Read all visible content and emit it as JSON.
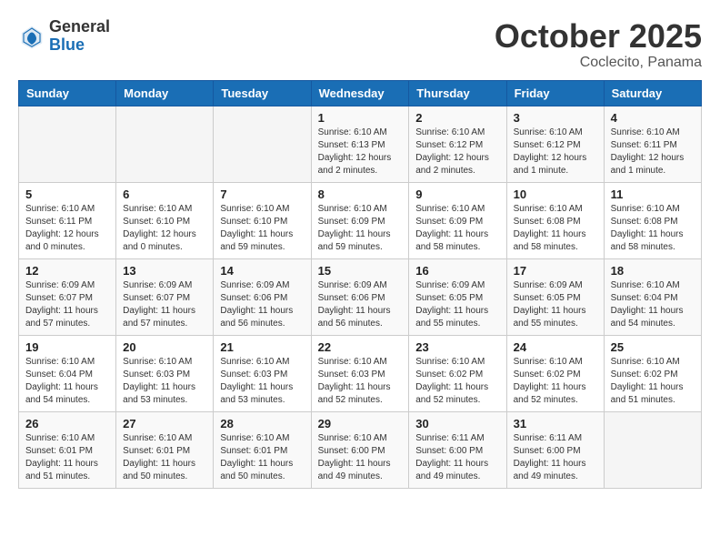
{
  "header": {
    "logo_general": "General",
    "logo_blue": "Blue",
    "month_title": "October 2025",
    "location": "Coclecito, Panama"
  },
  "days_of_week": [
    "Sunday",
    "Monday",
    "Tuesday",
    "Wednesday",
    "Thursday",
    "Friday",
    "Saturday"
  ],
  "weeks": [
    [
      {
        "day": "",
        "info": ""
      },
      {
        "day": "",
        "info": ""
      },
      {
        "day": "",
        "info": ""
      },
      {
        "day": "1",
        "info": "Sunrise: 6:10 AM\nSunset: 6:13 PM\nDaylight: 12 hours\nand 2 minutes."
      },
      {
        "day": "2",
        "info": "Sunrise: 6:10 AM\nSunset: 6:12 PM\nDaylight: 12 hours\nand 2 minutes."
      },
      {
        "day": "3",
        "info": "Sunrise: 6:10 AM\nSunset: 6:12 PM\nDaylight: 12 hours\nand 1 minute."
      },
      {
        "day": "4",
        "info": "Sunrise: 6:10 AM\nSunset: 6:11 PM\nDaylight: 12 hours\nand 1 minute."
      }
    ],
    [
      {
        "day": "5",
        "info": "Sunrise: 6:10 AM\nSunset: 6:11 PM\nDaylight: 12 hours\nand 0 minutes."
      },
      {
        "day": "6",
        "info": "Sunrise: 6:10 AM\nSunset: 6:10 PM\nDaylight: 12 hours\nand 0 minutes."
      },
      {
        "day": "7",
        "info": "Sunrise: 6:10 AM\nSunset: 6:10 PM\nDaylight: 11 hours\nand 59 minutes."
      },
      {
        "day": "8",
        "info": "Sunrise: 6:10 AM\nSunset: 6:09 PM\nDaylight: 11 hours\nand 59 minutes."
      },
      {
        "day": "9",
        "info": "Sunrise: 6:10 AM\nSunset: 6:09 PM\nDaylight: 11 hours\nand 58 minutes."
      },
      {
        "day": "10",
        "info": "Sunrise: 6:10 AM\nSunset: 6:08 PM\nDaylight: 11 hours\nand 58 minutes."
      },
      {
        "day": "11",
        "info": "Sunrise: 6:10 AM\nSunset: 6:08 PM\nDaylight: 11 hours\nand 58 minutes."
      }
    ],
    [
      {
        "day": "12",
        "info": "Sunrise: 6:09 AM\nSunset: 6:07 PM\nDaylight: 11 hours\nand 57 minutes."
      },
      {
        "day": "13",
        "info": "Sunrise: 6:09 AM\nSunset: 6:07 PM\nDaylight: 11 hours\nand 57 minutes."
      },
      {
        "day": "14",
        "info": "Sunrise: 6:09 AM\nSunset: 6:06 PM\nDaylight: 11 hours\nand 56 minutes."
      },
      {
        "day": "15",
        "info": "Sunrise: 6:09 AM\nSunset: 6:06 PM\nDaylight: 11 hours\nand 56 minutes."
      },
      {
        "day": "16",
        "info": "Sunrise: 6:09 AM\nSunset: 6:05 PM\nDaylight: 11 hours\nand 55 minutes."
      },
      {
        "day": "17",
        "info": "Sunrise: 6:09 AM\nSunset: 6:05 PM\nDaylight: 11 hours\nand 55 minutes."
      },
      {
        "day": "18",
        "info": "Sunrise: 6:10 AM\nSunset: 6:04 PM\nDaylight: 11 hours\nand 54 minutes."
      }
    ],
    [
      {
        "day": "19",
        "info": "Sunrise: 6:10 AM\nSunset: 6:04 PM\nDaylight: 11 hours\nand 54 minutes."
      },
      {
        "day": "20",
        "info": "Sunrise: 6:10 AM\nSunset: 6:03 PM\nDaylight: 11 hours\nand 53 minutes."
      },
      {
        "day": "21",
        "info": "Sunrise: 6:10 AM\nSunset: 6:03 PM\nDaylight: 11 hours\nand 53 minutes."
      },
      {
        "day": "22",
        "info": "Sunrise: 6:10 AM\nSunset: 6:03 PM\nDaylight: 11 hours\nand 52 minutes."
      },
      {
        "day": "23",
        "info": "Sunrise: 6:10 AM\nSunset: 6:02 PM\nDaylight: 11 hours\nand 52 minutes."
      },
      {
        "day": "24",
        "info": "Sunrise: 6:10 AM\nSunset: 6:02 PM\nDaylight: 11 hours\nand 52 minutes."
      },
      {
        "day": "25",
        "info": "Sunrise: 6:10 AM\nSunset: 6:02 PM\nDaylight: 11 hours\nand 51 minutes."
      }
    ],
    [
      {
        "day": "26",
        "info": "Sunrise: 6:10 AM\nSunset: 6:01 PM\nDaylight: 11 hours\nand 51 minutes."
      },
      {
        "day": "27",
        "info": "Sunrise: 6:10 AM\nSunset: 6:01 PM\nDaylight: 11 hours\nand 50 minutes."
      },
      {
        "day": "28",
        "info": "Sunrise: 6:10 AM\nSunset: 6:01 PM\nDaylight: 11 hours\nand 50 minutes."
      },
      {
        "day": "29",
        "info": "Sunrise: 6:10 AM\nSunset: 6:00 PM\nDaylight: 11 hours\nand 49 minutes."
      },
      {
        "day": "30",
        "info": "Sunrise: 6:11 AM\nSunset: 6:00 PM\nDaylight: 11 hours\nand 49 minutes."
      },
      {
        "day": "31",
        "info": "Sunrise: 6:11 AM\nSunset: 6:00 PM\nDaylight: 11 hours\nand 49 minutes."
      },
      {
        "day": "",
        "info": ""
      }
    ]
  ]
}
